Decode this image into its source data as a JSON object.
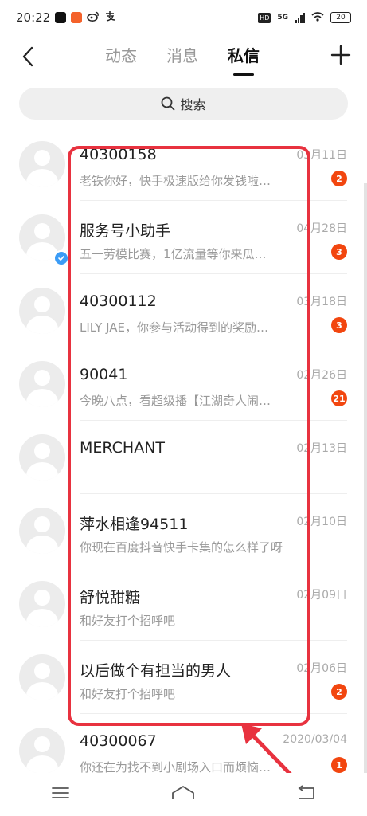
{
  "status_bar": {
    "time": "20:22",
    "network": "5G",
    "battery": "20"
  },
  "nav": {
    "tabs": [
      {
        "label": "动态",
        "active": false
      },
      {
        "label": "消息",
        "active": false
      },
      {
        "label": "私信",
        "active": true
      }
    ]
  },
  "search": {
    "label": "搜索"
  },
  "conversations": [
    {
      "name": "40300158",
      "preview": "老铁你好，快手极速版给你发钱啦…",
      "date": "03月11日",
      "badge": "2",
      "verified": false
    },
    {
      "name": "服务号小助手",
      "preview": "五一劳模比赛，1亿流量等你来瓜…",
      "date": "04月28日",
      "badge": "3",
      "verified": true
    },
    {
      "name": "40300112",
      "preview": "LILY JAE，你参与活动得到的奖励…",
      "date": "03月18日",
      "badge": "3",
      "verified": false
    },
    {
      "name": "90041",
      "preview": "今晚八点，看超级播【江湖奇人闹…",
      "date": "02月26日",
      "badge": "21",
      "verified": false
    },
    {
      "name": "MERCHANT",
      "preview": "",
      "date": "02月13日",
      "badge": "",
      "verified": false
    },
    {
      "name": "萍水相逢94511",
      "preview": "你现在百度抖音快手卡集的怎么样了呀",
      "date": "02月10日",
      "badge": "",
      "verified": false
    },
    {
      "name": "舒悦甜糖",
      "preview": "和好友打个招呼吧",
      "date": "02月09日",
      "badge": "",
      "verified": false
    },
    {
      "name": "以后做个有担当的男人",
      "preview": "和好友打个招呼吧",
      "date": "02月06日",
      "badge": "2",
      "verified": false
    },
    {
      "name": "40300067",
      "preview": "你还在为找不到小剧场入口而烦恼…",
      "date": "2020/03/04",
      "badge": "1",
      "verified": false
    }
  ],
  "colors": {
    "badge": "#f2460f",
    "highlight": "#e8323f",
    "verified": "#3b9cf6"
  },
  "icons": {
    "back": "back-arrow-icon",
    "add": "plus-icon",
    "search": "search-icon",
    "menu": "menu-icon",
    "home": "home-icon",
    "return": "return-icon"
  }
}
